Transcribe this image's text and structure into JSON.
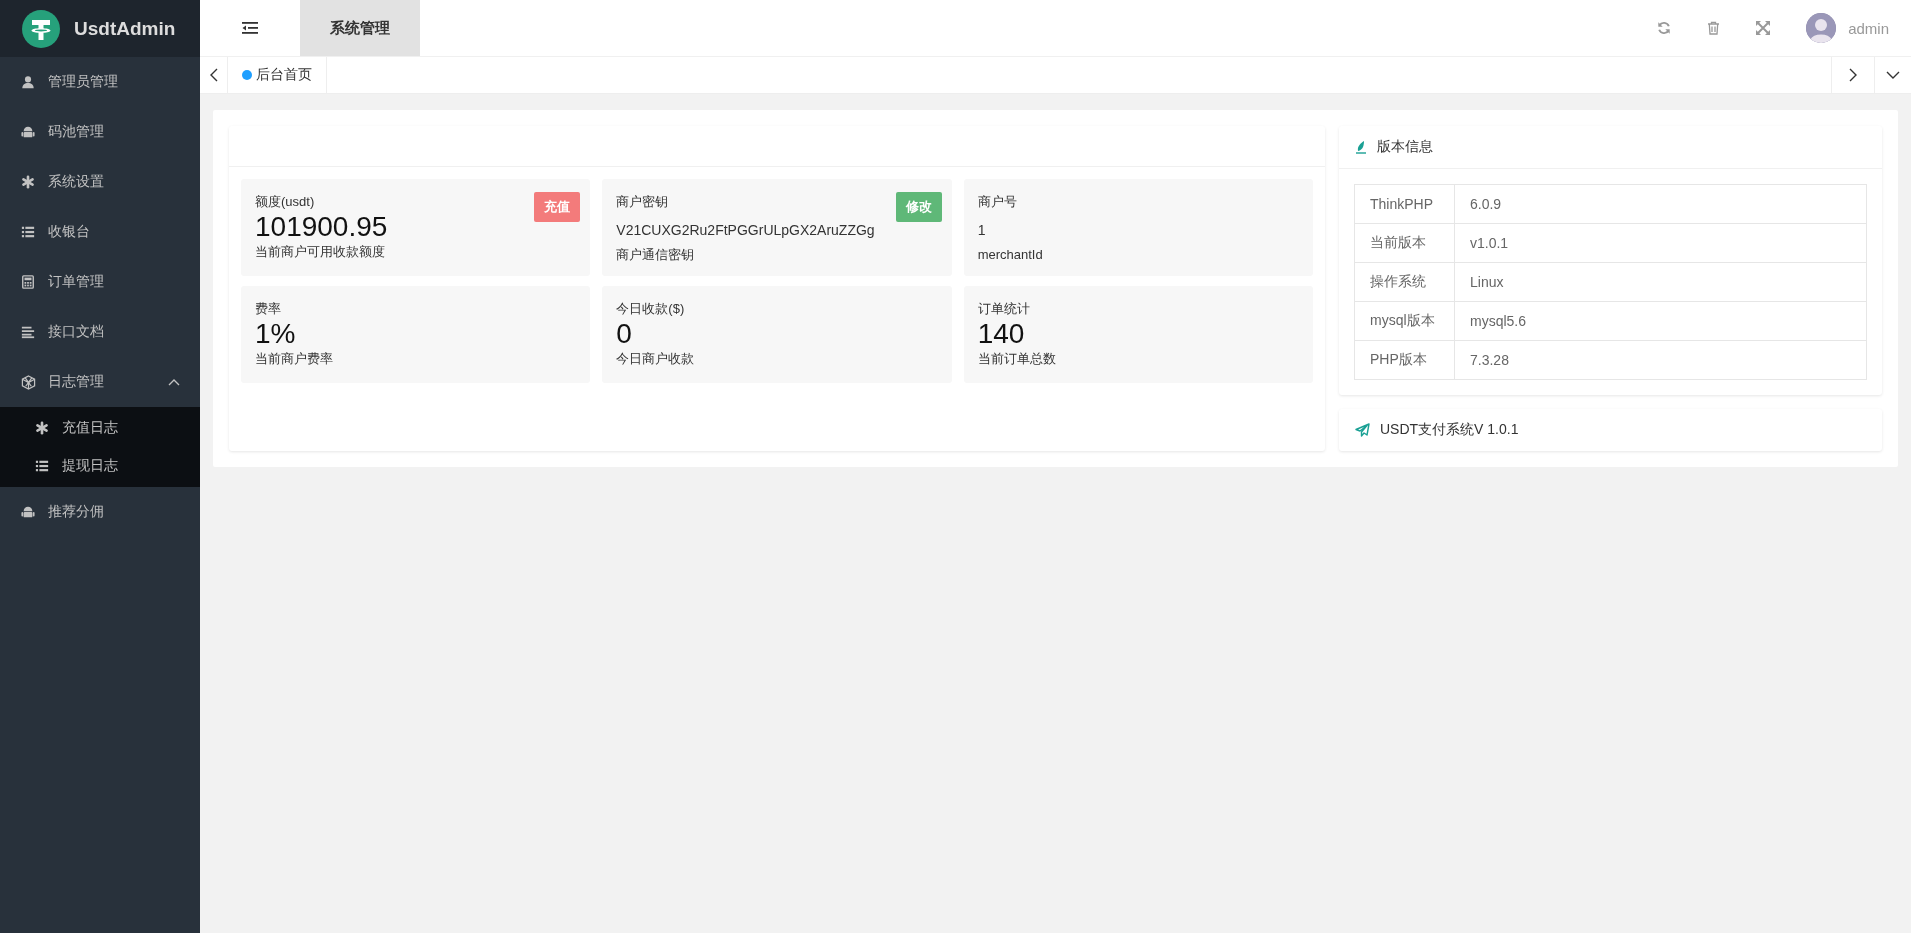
{
  "logo": {
    "title": "UsdtAdmin"
  },
  "sidebar": {
    "items": [
      {
        "label": "管理员管理"
      },
      {
        "label": "码池管理"
      },
      {
        "label": "系统设置"
      },
      {
        "label": "收银台"
      },
      {
        "label": "订单管理"
      },
      {
        "label": "接口文档"
      },
      {
        "label": "日志管理",
        "expanded": true,
        "children": [
          {
            "label": "充值日志"
          },
          {
            "label": "提现日志"
          }
        ]
      },
      {
        "label": "推荐分佣"
      }
    ]
  },
  "header": {
    "tabs": [
      {
        "label": "系统管理",
        "selected": true
      }
    ],
    "user": "admin"
  },
  "page_tabs": [
    {
      "label": "后台首页",
      "selected": true
    }
  ],
  "stats": [
    {
      "kind": "big",
      "label": "额度(usdt)",
      "value": "101900.95",
      "caption": "当前商户可用收款额度",
      "button": {
        "label": "充值",
        "color": "#f37b7b"
      }
    },
    {
      "kind": "text",
      "label": "商户密钥",
      "value": "V21CUXG2Ru2FtPGGrULpGX2AruZZGg",
      "caption": "商户通信密钥",
      "button": {
        "label": "修改",
        "color": "#5fb878"
      }
    },
    {
      "kind": "text",
      "label": "商户号",
      "value": "1",
      "caption": "merchantId"
    },
    {
      "kind": "big",
      "label": "费率",
      "value": "1%",
      "caption": "当前商户费率"
    },
    {
      "kind": "big",
      "label": "今日收款($)",
      "value": "0",
      "caption": "今日商户收款"
    },
    {
      "kind": "big",
      "label": "订单统计",
      "value": "140",
      "caption": "当前订单总数"
    }
  ],
  "version_info": {
    "title": "版本信息",
    "rows": [
      [
        "ThinkPHP",
        "6.0.9"
      ],
      [
        "当前版本",
        "v1.0.1"
      ],
      [
        "操作系统",
        "Linux"
      ],
      [
        "mysql版本",
        "mysql5.6"
      ],
      [
        "PHP版本",
        "7.3.28"
      ]
    ]
  },
  "footer_card": {
    "text": "USDT支付系统V 1.0.1"
  }
}
